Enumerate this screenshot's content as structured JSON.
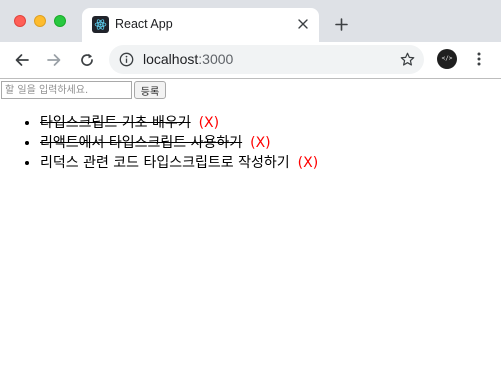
{
  "browser": {
    "tab": {
      "title": "React App"
    },
    "address": {
      "host": "localhost",
      "port": ":3000"
    },
    "extension_label": "</>"
  },
  "app": {
    "input": {
      "placeholder": "할 일을 입력하세요.",
      "value": ""
    },
    "add_button_label": "등록",
    "todos": [
      {
        "text": "타입스크립트 기초 배우기",
        "done": true,
        "delete_label": "(X)"
      },
      {
        "text": "리액트에서 타입스크립트 사용하기",
        "done": true,
        "delete_label": "(X)"
      },
      {
        "text": "리덕스 관련 코드 타입스크립트로 작성하기",
        "done": false,
        "delete_label": "(X)"
      }
    ]
  },
  "colors": {
    "delete_accent": "#ff0000",
    "tabstrip_bg": "#dee1e6",
    "omnibox_bg": "#f1f3f4"
  }
}
